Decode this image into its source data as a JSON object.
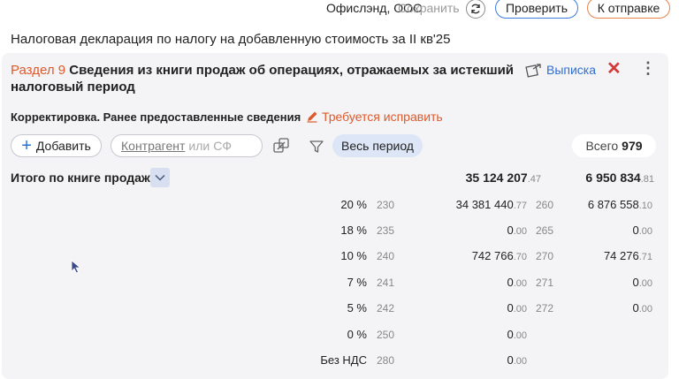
{
  "topbar": {
    "org": "Офислэнд, ООО",
    "save_label": "Сохранить",
    "check_label": "Проверить",
    "send_label": "К отправке"
  },
  "document": {
    "title": "Налоговая декларация по налогу на добавленную стоимость за II кв'25"
  },
  "section": {
    "number": "Раздел 9",
    "title": "Сведения из книги продаж об операциях, отражаемых за истекший налоговый период",
    "extract_label": "Выписка",
    "correction": "Корректировка. Ранее предоставленные сведения",
    "fix_label": "Требуется исправить"
  },
  "toolbar": {
    "add_label": "Добавить",
    "search_contractor": "Контрагент",
    "search_or": "или",
    "search_sf": "СФ",
    "period_label": "Весь период",
    "total_label": "Всего",
    "total_value": "979"
  },
  "summary": {
    "label": "Итого по книге продаж",
    "base_int": "35 124 207",
    "base_kop": ".47",
    "tax_int": "6 950 834",
    "tax_kop": ".81"
  },
  "rows": [
    {
      "rate": "20 %",
      "code1": "230",
      "v1_int": "34 381 440",
      "v1_kop": ".77",
      "code2": "260",
      "v2_int": "6 876 558",
      "v2_kop": ".10"
    },
    {
      "rate": "18 %",
      "code1": "235",
      "v1_int": "0",
      "v1_kop": ".00",
      "code2": "265",
      "v2_int": "0",
      "v2_kop": ".00"
    },
    {
      "rate": "10 %",
      "code1": "240",
      "v1_int": "742 766",
      "v1_kop": ".70",
      "code2": "270",
      "v2_int": "74 276",
      "v2_kop": ".71"
    },
    {
      "rate": "7 %",
      "code1": "241",
      "v1_int": "0",
      "v1_kop": ".00",
      "code2": "271",
      "v2_int": "0",
      "v2_kop": ".00"
    },
    {
      "rate": "5 %",
      "code1": "242",
      "v1_int": "0",
      "v1_kop": ".00",
      "code2": "272",
      "v2_int": "0",
      "v2_kop": ".00"
    },
    {
      "rate": "0 %",
      "code1": "250",
      "v1_int": "0",
      "v1_kop": ".00",
      "code2": "",
      "v2_int": "",
      "v2_kop": ""
    },
    {
      "rate": "Без НДС",
      "code1": "280",
      "v1_int": "0",
      "v1_kop": ".00",
      "code2": "",
      "v2_int": "",
      "v2_kop": ""
    }
  ],
  "icons": {
    "sync": "sync-icon",
    "extract": "document-export-icon",
    "close": "close-icon",
    "more": "kebab-menu-icon",
    "pencil": "pencil-icon",
    "plus": "plus-icon",
    "link": "link-icon",
    "filter": "filter-icon",
    "chevron": "chevron-down-icon",
    "cursor": "mouse-cursor-icon"
  },
  "colors": {
    "accent_blue": "#2b6fd6",
    "accent_orange": "#e0592a",
    "close_red": "#d23a3a",
    "panel_bg": "#f4f4f6",
    "period_bg": "#dde6f6"
  }
}
